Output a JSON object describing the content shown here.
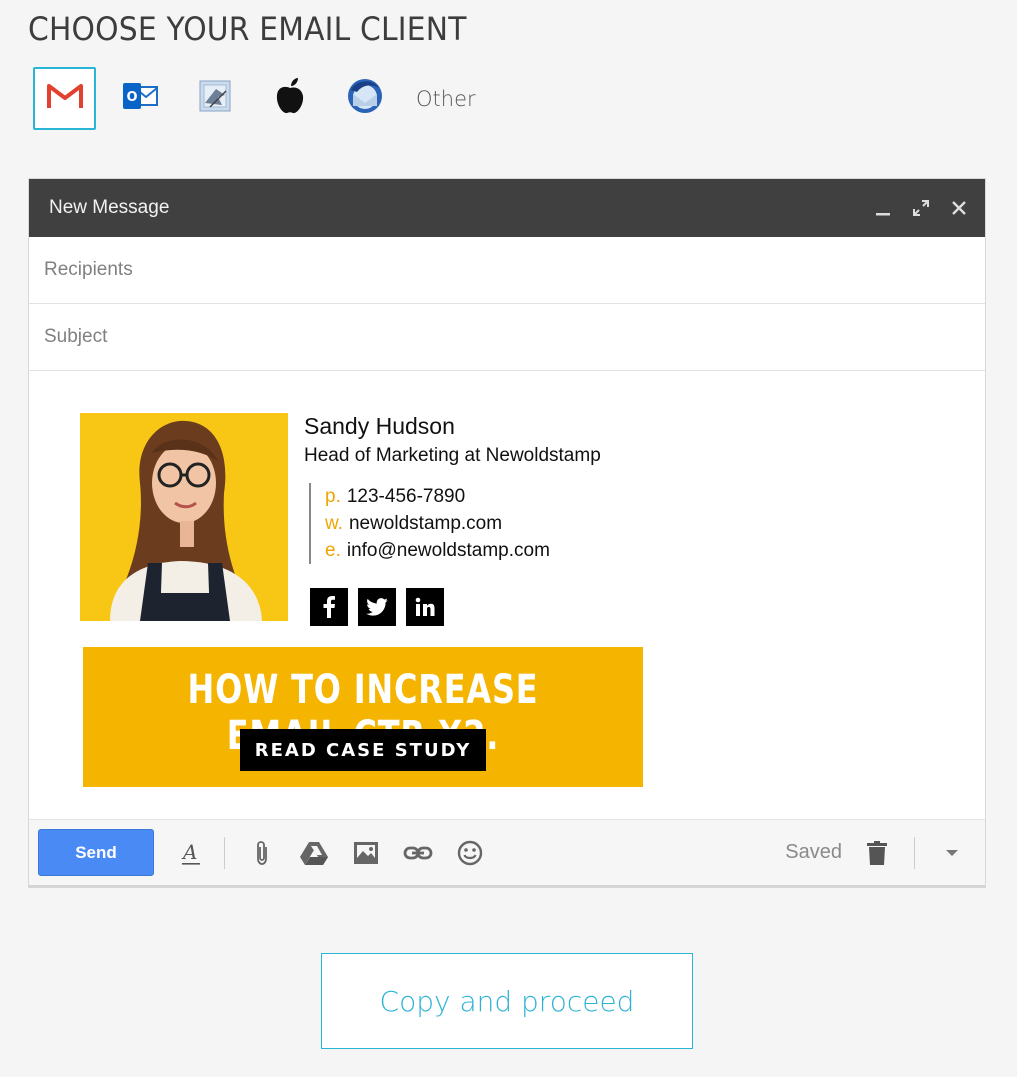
{
  "page": {
    "title": "CHOOSE YOUR EMAIL CLIENT"
  },
  "clients": {
    "items": [
      {
        "name": "gmail-icon",
        "selected": true
      },
      {
        "name": "outlook-icon",
        "selected": false
      },
      {
        "name": "apple-mail-icon",
        "selected": false
      },
      {
        "name": "apple-icon",
        "selected": false
      },
      {
        "name": "thunderbird-icon",
        "selected": false
      }
    ],
    "other_label": "Other"
  },
  "compose": {
    "title": "New Message",
    "recipients_placeholder": "Recipients",
    "subject_placeholder": "Subject"
  },
  "signature": {
    "name": "Sandy Hudson",
    "role": "Head of Marketing at Newoldstamp",
    "phone_label": "p.",
    "phone": "123-456-7890",
    "web_label": "w.",
    "web": "newoldstamp.com",
    "email_label": "e.",
    "email": "info@newoldstamp.com",
    "socials": {
      "facebook": "f",
      "twitter": "t",
      "linkedin": "in"
    },
    "banner": {
      "headline": "HOW TO INCREASE EMAIL CTR X2.",
      "cta": "READ CASE STUDY"
    }
  },
  "toolbar": {
    "send_label": "Send",
    "saved_label": "Saved"
  },
  "cta": {
    "copy_label": "Copy and proceed"
  },
  "colors": {
    "accent": "#29b6d6",
    "banner": "#f4b400",
    "label": "#f0a500",
    "send": "#4a8af4",
    "header": "#404040"
  }
}
